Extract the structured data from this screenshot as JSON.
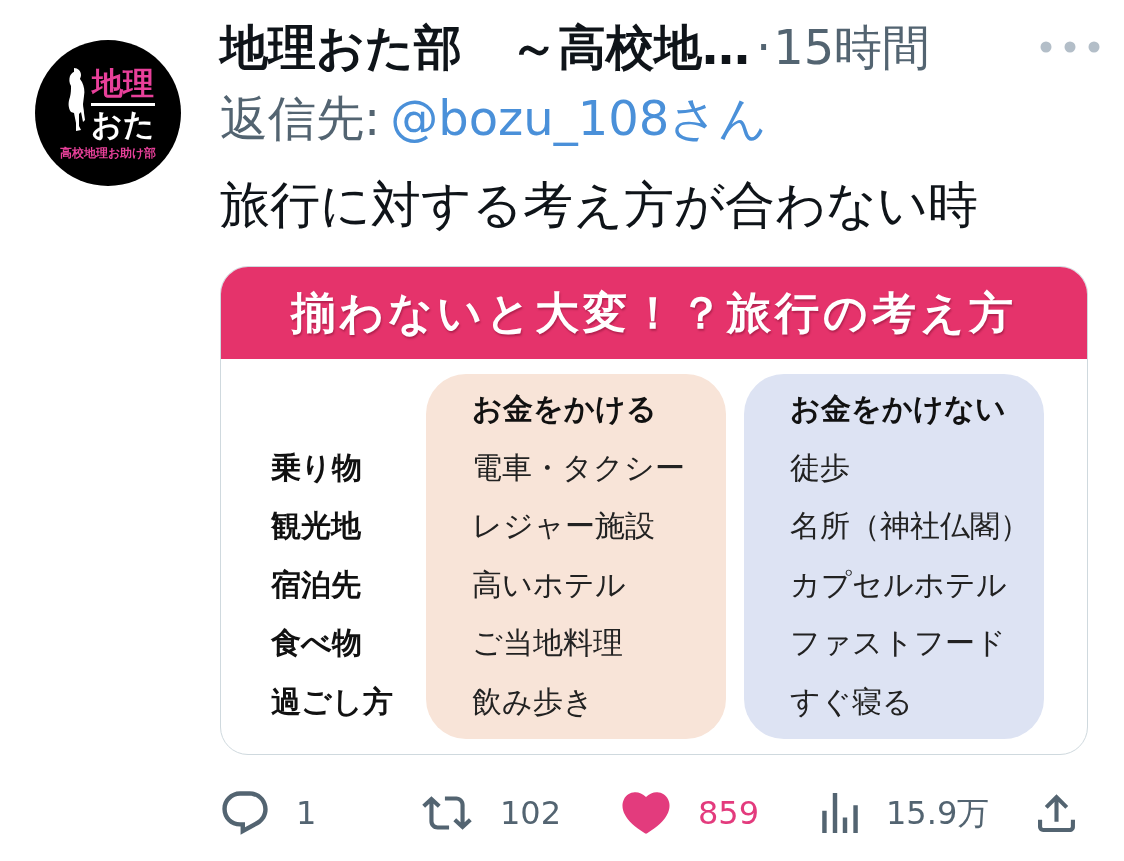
{
  "avatar": {
    "line_1": "地理",
    "line_2": "おた",
    "caption": "高校地理お助け部"
  },
  "header": {
    "display_name": "地理おた部　～高校地…",
    "separator": "·",
    "time": "15時間"
  },
  "reply_to": {
    "label": "返信先:",
    "handle": "@bozu_108さん"
  },
  "text": "旅行に対する考え方が合わない時",
  "image": {
    "title": "揃わないと大変！？旅行の考え方",
    "row_labels": [
      "乗り物",
      "観光地",
      "宿泊先",
      "食べ物",
      "過ごし方"
    ],
    "columns": [
      {
        "heading": "お金をかける",
        "color": "#f8e4d8",
        "cells": [
          "電車・タクシー",
          "レジャー施設",
          "高いホテル",
          "ご当地料理",
          "飲み歩き"
        ]
      },
      {
        "heading": "お金をかけない",
        "color": "#dde3f3",
        "cells": [
          "徒歩",
          "名所（神社仏閣）",
          "カプセルホテル",
          "ファストフード",
          "すぐ寝る"
        ]
      }
    ]
  },
  "actions": [
    {
      "kind": "reply",
      "count": "1",
      "active": false
    },
    {
      "kind": "repost",
      "count": "102",
      "active": false
    },
    {
      "kind": "like",
      "count": "859",
      "active": true
    },
    {
      "kind": "views",
      "count": "15.9万",
      "active": false
    },
    {
      "kind": "share",
      "active": false
    }
  ]
}
